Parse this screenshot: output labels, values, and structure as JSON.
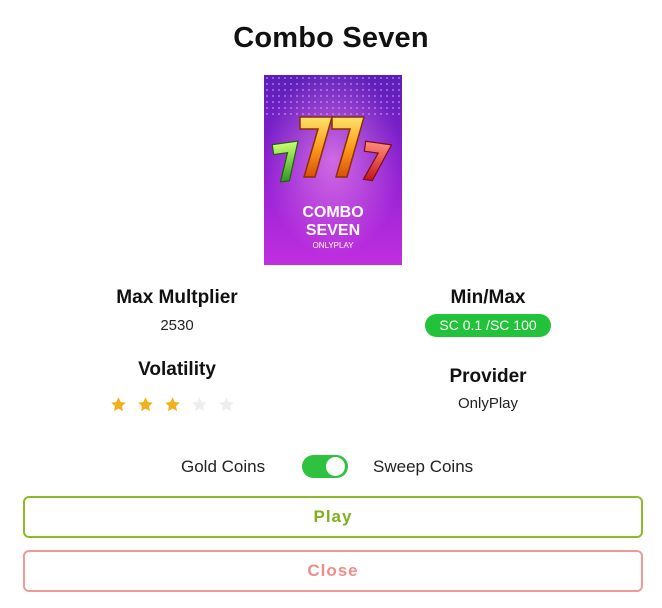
{
  "game": {
    "title": "Combo Seven",
    "thumbnail": {
      "line1": "COMBO",
      "line2": "SEVEN",
      "provider_tag": "ONLYPLAY"
    }
  },
  "stats": {
    "max_multiplier_label": "Max Multplier",
    "max_multiplier_value": "2530",
    "minmax_label": "Min/Max",
    "minmax_value": "SC 0.1 /SC 100",
    "volatility_label": "Volatility",
    "volatility_rating": 3,
    "volatility_max": 5,
    "provider_label": "Provider",
    "provider_value": "OnlyPlay"
  },
  "currency_toggle": {
    "left_label": "Gold Coins",
    "right_label": "Sweep Coins",
    "selected": "Sweep Coins"
  },
  "buttons": {
    "play_label": "Play",
    "close_label": "Close"
  },
  "colors": {
    "accent_green": "#22c33a",
    "play_border": "#8dbb25",
    "close_border": "#f09a98",
    "star_filled": "#f2b01e",
    "star_empty": "#eeeeee"
  }
}
